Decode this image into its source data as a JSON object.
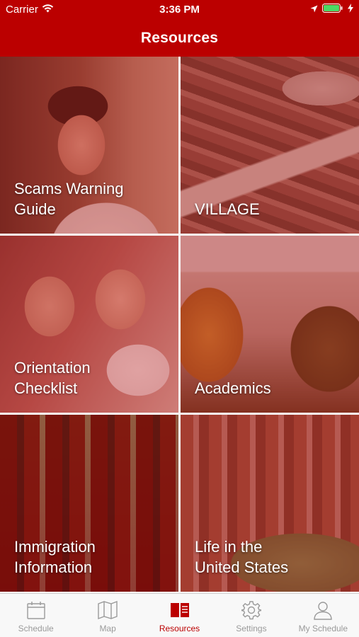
{
  "status_bar": {
    "carrier": "Carrier",
    "time": "3:36 PM"
  },
  "nav": {
    "title": "Resources"
  },
  "tiles": [
    {
      "label_line1": "Scams Warning",
      "label_line2": "Guide"
    },
    {
      "label_line1": "VILLAGE",
      "label_line2": ""
    },
    {
      "label_line1": "Orientation",
      "label_line2": "Checklist"
    },
    {
      "label_line1": "Academics",
      "label_line2": ""
    },
    {
      "label_line1": "Immigration",
      "label_line2": "Information"
    },
    {
      "label_line1": "Life in the",
      "label_line2": "United States"
    }
  ],
  "tab_bar": {
    "tabs": [
      {
        "label": "Schedule",
        "icon": "calendar-icon",
        "active": false
      },
      {
        "label": "Map",
        "icon": "map-icon",
        "active": false
      },
      {
        "label": "Resources",
        "icon": "book-icon",
        "active": true
      },
      {
        "label": "Settings",
        "icon": "gear-icon",
        "active": false
      },
      {
        "label": "My Schedule",
        "icon": "person-icon",
        "active": false
      }
    ]
  },
  "colors": {
    "brand": "#bb0000",
    "tab_inactive": "#9a9a9a",
    "battery": "#4cd964"
  }
}
